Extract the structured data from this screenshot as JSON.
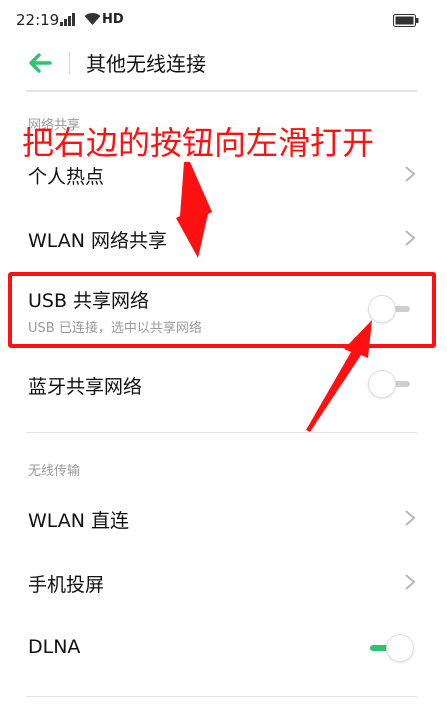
{
  "status_bar": {
    "time": "22:19",
    "network": "HD"
  },
  "header": {
    "title": "其他无线连接"
  },
  "sections": {
    "network_sharing": "网络共享",
    "wireless_transfer": "无线传输"
  },
  "rows": {
    "hotspot": "个人热点",
    "wlan_sharing": "WLAN 网络共享",
    "usb_sharing": "USB 共享网络",
    "usb_sharing_sub": "USB 已连接，选中以共享网络",
    "bt_sharing": "蓝牙共享网络",
    "wlan_direct": "WLAN 直连",
    "screen_cast": "手机投屏",
    "dlna": "DLNA"
  },
  "toggles": {
    "usb_sharing": false,
    "bt_sharing": false,
    "dlna": true
  },
  "annotation": {
    "text": "把右边的按钮向左滑打开"
  },
  "colors": {
    "accent": "#2ec271",
    "annotation": "#ff1111"
  }
}
